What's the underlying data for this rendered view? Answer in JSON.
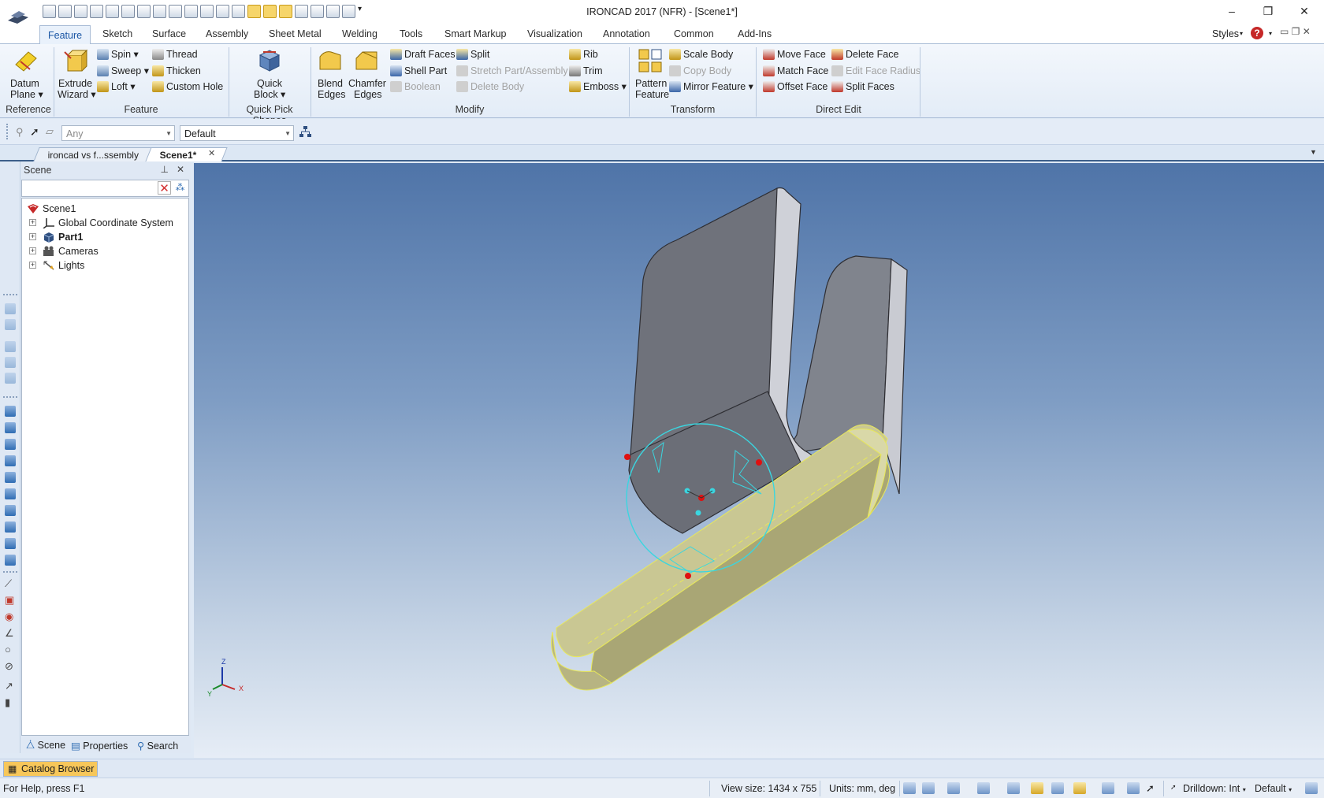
{
  "window": {
    "title": "IRONCAD 2017 (NFR) - [Scene1*]",
    "minimize": "–",
    "restore": "❐",
    "close": "✕"
  },
  "ribbon_tabs": [
    "Feature",
    "Sketch",
    "Surface",
    "Assembly",
    "Sheet Metal",
    "Welding",
    "Tools",
    "Smart Markup",
    "Visualization",
    "Annotation",
    "Common",
    "Add-Ins"
  ],
  "styles_label": "Styles",
  "help_glyph": "?",
  "ribbon": {
    "reference": {
      "datum_plane": "Datum",
      "datum_plane2": "Plane",
      "group": "Reference"
    },
    "feature": {
      "extrude": "Extrude",
      "extrude2": "Wizard",
      "spin": "Spin",
      "sweep": "Sweep",
      "loft": "Loft",
      "thread": "Thread",
      "thicken": "Thicken",
      "custom_hole": "Custom Hole",
      "group": "Feature"
    },
    "quickpick": {
      "quick_block": "Quick",
      "quick_block2": "Block",
      "group": "Quick Pick Shapes"
    },
    "modify": {
      "blend": "Blend",
      "blend2": "Edges",
      "chamfer": "Chamfer",
      "chamfer2": "Edges",
      "draft_faces": "Draft Faces",
      "shell_part": "Shell Part",
      "boolean": "Boolean",
      "split": "Split",
      "stretch": "Stretch Part/Assembly",
      "delete_body": "Delete Body",
      "rib": "Rib",
      "trim": "Trim",
      "emboss": "Emboss",
      "group": "Modify"
    },
    "transform": {
      "pattern": "Pattern",
      "pattern2": "Feature",
      "scale_body": "Scale Body",
      "copy_body": "Copy Body",
      "mirror_feature": "Mirror Feature",
      "group": "Transform"
    },
    "direct_edit": {
      "move_face": "Move Face",
      "match_face": "Match Face",
      "offset_face": "Offset Face",
      "delete_face": "Delete Face",
      "edit_face_radius": "Edit Face Radius",
      "split_faces": "Split Faces",
      "group": "Direct Edit"
    }
  },
  "selection": {
    "filter": "Any",
    "style": "Default"
  },
  "doc_tabs": [
    "ironcad vs f...ssembly",
    "Scene1*"
  ],
  "scene_panel": {
    "title": "Scene",
    "pin": "⊥",
    "close": "✕",
    "tree": [
      {
        "label": "Scene1",
        "bold": false,
        "root": true
      },
      {
        "label": "Global Coordinate System",
        "bold": false
      },
      {
        "label": "Part1",
        "bold": true
      },
      {
        "label": "Cameras",
        "bold": false
      },
      {
        "label": "Lights",
        "bold": false
      }
    ],
    "footer_tabs": [
      "Scene",
      "Properties",
      "Search"
    ]
  },
  "triad": {
    "z": "Z",
    "y": "Y",
    "x": "X"
  },
  "catalog_browser": "Catalog Browser",
  "status": {
    "help": "For Help, press F1",
    "view_size": "View size: 1434 x  755",
    "units": "Units: mm, deg",
    "drilldown": "Drilldown: Int",
    "style": "Default"
  },
  "colors": {
    "viewport_top": "#4f74a8",
    "viewport_bottom": "#e6edf6",
    "part_gray": "#8a8d96",
    "part_yellow": "#cfcf9c",
    "selection_cyan": "#3ad6e0",
    "handle_red": "#e01010"
  }
}
